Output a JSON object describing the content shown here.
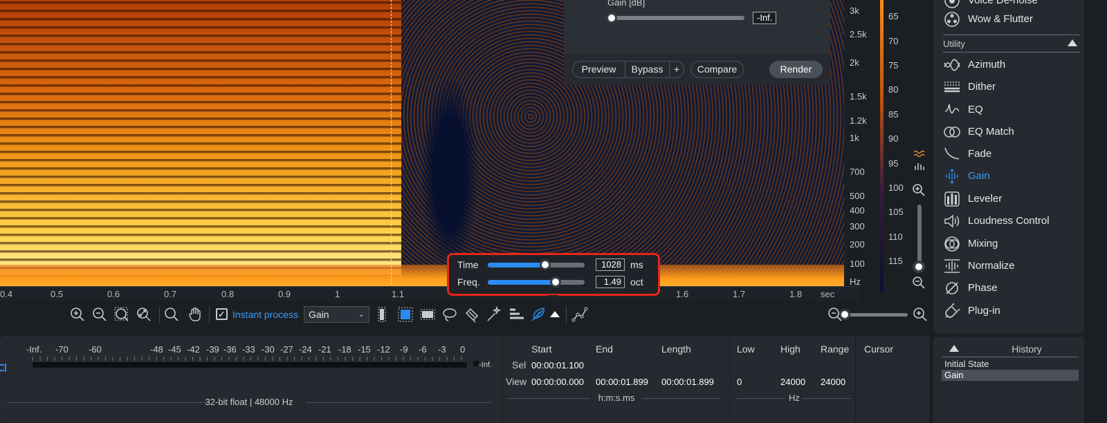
{
  "gain_panel": {
    "param_label": "Gain [dB]",
    "gain_value": "-Inf.",
    "buttons": {
      "preview": "Preview",
      "bypass": "Bypass",
      "plus": "+",
      "compare": "Compare",
      "render": "Render"
    }
  },
  "freq_scale": {
    "ticks": [
      "3k",
      "2.5k",
      "2k",
      "1.5k",
      "1.2k",
      "1k",
      "700",
      "500",
      "400",
      "300",
      "200",
      "100",
      "Hz"
    ]
  },
  "db_scale": {
    "ticks": [
      "65",
      "70",
      "75",
      "80",
      "85",
      "90",
      "95",
      "100",
      "105",
      "110",
      "115"
    ]
  },
  "time_axis": {
    "ticks": [
      "0.4",
      "0.5",
      "0.6",
      "0.7",
      "0.8",
      "0.9",
      "1",
      "1.1",
      "1.6",
      "1.7",
      "1.8",
      "sec"
    ]
  },
  "resolution_popup": {
    "time": {
      "label": "Time",
      "value": "1028",
      "unit": "ms",
      "position": 0.59
    },
    "freq": {
      "label": "Freq.",
      "value": "1.49",
      "unit": "oct",
      "position": 0.7
    }
  },
  "toolbar": {
    "instant_process_label": "Instant process",
    "instant_process_checked": "✓",
    "module_select": "Gain",
    "accent_color": "#2a8cf0"
  },
  "meter": {
    "scale": [
      "-Inf.",
      "-70",
      "-60",
      "-48",
      "-45",
      "-42",
      "-39",
      "-36",
      "-33",
      "-30",
      "-27",
      "-24",
      "-21",
      "-18",
      "-15",
      "-12",
      "-9",
      "-6",
      "-3",
      "0"
    ],
    "peak_label": "-Inf.",
    "format": "32-bit float | 48000 Hz"
  },
  "selection": {
    "headers": {
      "start": "Start",
      "end": "End",
      "length": "Length"
    },
    "sel": {
      "label": "Sel",
      "start": "00:00:01.100",
      "end": "",
      "length": ""
    },
    "view": {
      "label": "View",
      "start": "00:00:00.000",
      "end": "00:00:01.899",
      "length": "00:00:01.899"
    },
    "units": "h:m:s.ms"
  },
  "range": {
    "headers": {
      "low": "Low",
      "high": "High",
      "range": "Range"
    },
    "values": {
      "low": "0",
      "high": "24000",
      "range": "24000"
    },
    "units": "Hz"
  },
  "cursor": {
    "header": "Cursor"
  },
  "sidebar": {
    "top_items": [
      {
        "label": "Voice De-noise",
        "icon": "voice-denoise-icon"
      },
      {
        "label": "Wow & Flutter",
        "icon": "wow-flutter-icon"
      }
    ],
    "group": "Utility",
    "items": [
      {
        "label": "Azimuth",
        "icon": "azimuth-icon"
      },
      {
        "label": "Dither",
        "icon": "dither-icon"
      },
      {
        "label": "EQ",
        "icon": "eq-icon"
      },
      {
        "label": "EQ Match",
        "icon": "eq-match-icon"
      },
      {
        "label": "Fade",
        "icon": "fade-icon"
      },
      {
        "label": "Gain",
        "icon": "gain-icon",
        "active": true
      },
      {
        "label": "Leveler",
        "icon": "leveler-icon"
      },
      {
        "label": "Loudness Control",
        "icon": "loudness-control-icon"
      },
      {
        "label": "Mixing",
        "icon": "mixing-icon"
      },
      {
        "label": "Normalize",
        "icon": "normalize-icon"
      },
      {
        "label": "Phase",
        "icon": "phase-icon"
      },
      {
        "label": "Plug-in",
        "icon": "plug-in-icon"
      }
    ]
  },
  "history": {
    "title": "History",
    "items": [
      "Initial State",
      "Gain"
    ]
  }
}
